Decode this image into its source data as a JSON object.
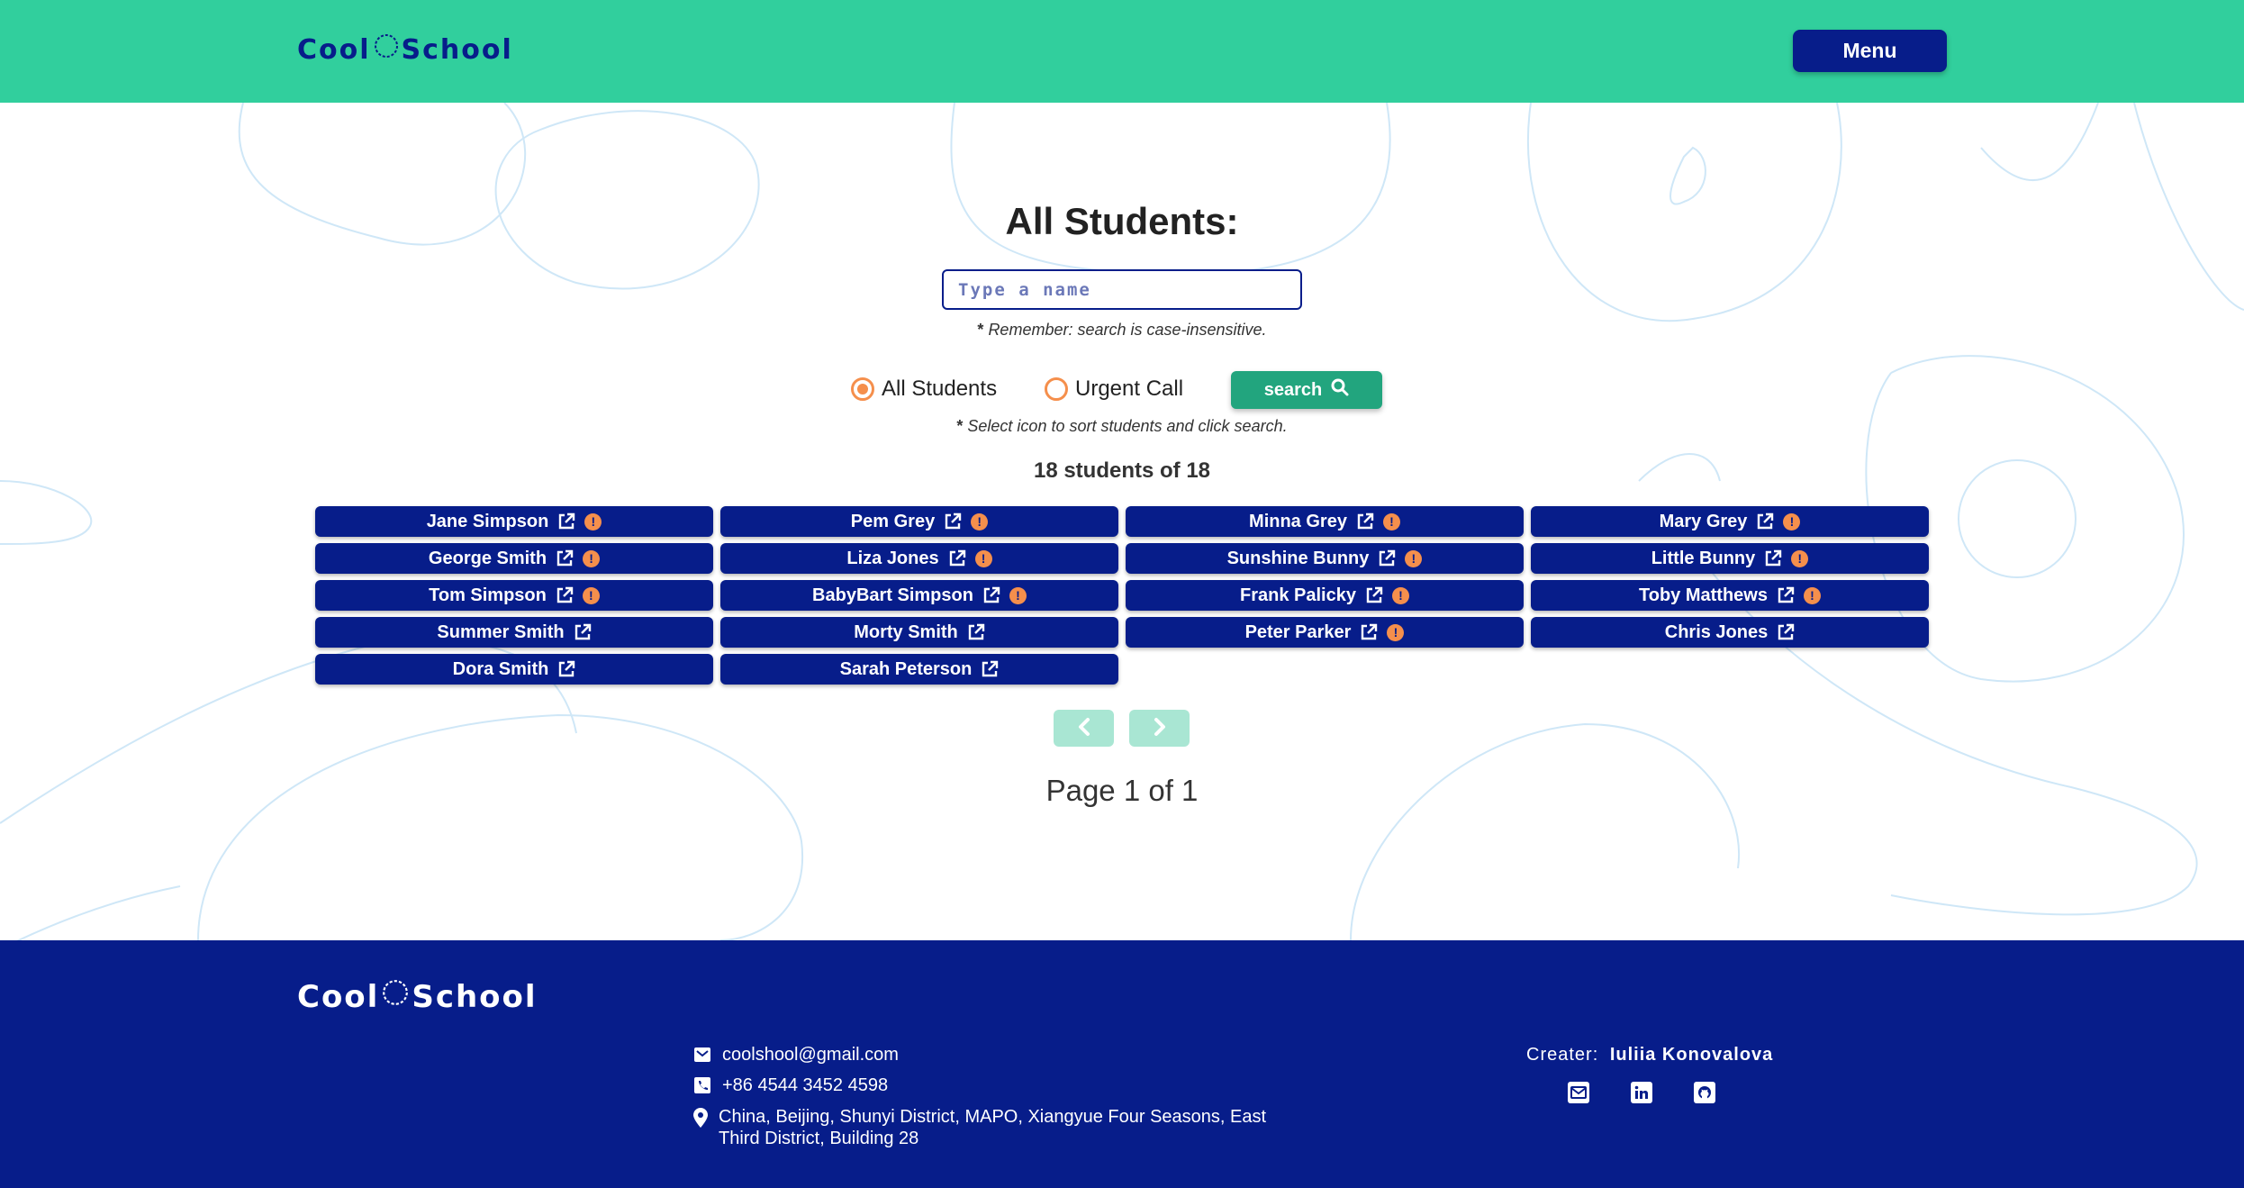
{
  "header": {
    "logo_left": "Cool",
    "logo_right": "School",
    "menu_label": "Menu"
  },
  "main": {
    "title": "All Students:",
    "search": {
      "placeholder": "Type a name",
      "value": ""
    },
    "hint_search": "Remember: search is case-insensitive.",
    "hint_sort": "Select icon to sort students and click search.",
    "filters": {
      "all_label": "All Students",
      "urgent_label": "Urgent Call",
      "selected": "All Students"
    },
    "search_button": "search",
    "count_text": "18 students of 18",
    "students": [
      {
        "name": "Jane Simpson",
        "urgent": true
      },
      {
        "name": "Pem Grey",
        "urgent": true
      },
      {
        "name": "Minna Grey",
        "urgent": true
      },
      {
        "name": "Mary Grey",
        "urgent": true
      },
      {
        "name": "George Smith",
        "urgent": true
      },
      {
        "name": "Liza Jones",
        "urgent": true
      },
      {
        "name": "Sunshine Bunny",
        "urgent": true
      },
      {
        "name": "Little Bunny",
        "urgent": true
      },
      {
        "name": "Tom Simpson",
        "urgent": true
      },
      {
        "name": "BabyBart Simpson",
        "urgent": true
      },
      {
        "name": "Frank Palicky",
        "urgent": true
      },
      {
        "name": "Toby Matthews",
        "urgent": true
      },
      {
        "name": "Summer Smith",
        "urgent": false
      },
      {
        "name": "Morty Smith",
        "urgent": false
      },
      {
        "name": "Peter Parker",
        "urgent": true
      },
      {
        "name": "Chris Jones",
        "urgent": false
      },
      {
        "name": "Dora Smith",
        "urgent": false
      },
      {
        "name": "Sarah Peterson",
        "urgent": false
      }
    ],
    "pagination": {
      "page_text": "Page 1 of 1"
    }
  },
  "footer": {
    "logo_left": "Cool",
    "logo_right": "School",
    "email": "coolshool@gmail.com",
    "phone": "+86 4544 3452 4598",
    "address": "China, Beijing, Shunyi District, MAPO, Xiangyue Four Seasons, East Third District, Building 28",
    "creator_label": "Creater:",
    "creator_name": "Iuliia Konovalova"
  },
  "colors": {
    "header_bg": "#31cf9d",
    "brand_blue": "#071d8a",
    "accent_orange": "#f58f4c",
    "search_green": "#22a57e",
    "pager_disabled": "#a9e6d3"
  },
  "icons": {
    "student_link": "external-link-icon",
    "student_urgent": "exclamation-circle-icon",
    "search": "magnifier-icon",
    "prev": "chevron-left-icon",
    "next": "chevron-right-icon",
    "email": "envelope-icon",
    "phone": "phone-icon",
    "address": "map-pin-icon",
    "socials": [
      "envelope-icon",
      "linkedin-icon",
      "github-icon"
    ]
  }
}
